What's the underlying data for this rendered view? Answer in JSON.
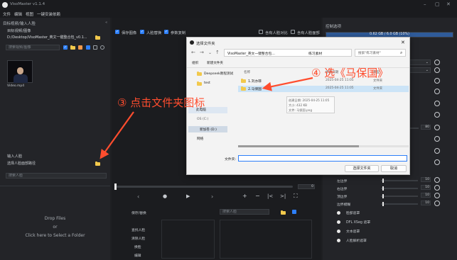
{
  "app": {
    "title": "VisoMaster v1.1.4"
  },
  "menu": [
    "文件",
    "编辑",
    "视图",
    "一键安装依赖"
  ],
  "left_panel": {
    "title": "目标视频/输入人脸",
    "target_label": "目标视频/图像",
    "target_path": "D:/Desktop/VisoMaster_英文一键整合包_v0.1...",
    "search_placeholder": "搜索视频/图像",
    "thumb_caption": "Video.mp4",
    "input_faces_label": "输入人脸",
    "input_faces_select": "选择人脸面部路径",
    "input_search_placeholder": "搜索人脸",
    "drop_files": "Drop Files",
    "or": "or",
    "click_select": "Click here to Select a Folder"
  },
  "center_top": {
    "checkbox1": "保存图像",
    "checkbox2": "人脸替换",
    "checkbox3": "参数复制",
    "right_cb1": "含有人脸对比",
    "right_cb2": "含有人脸面部"
  },
  "video_controls": {
    "frame_value": "0"
  },
  "bottom_center": {
    "save_label": "保存/替换",
    "search_face": "搜索人脸",
    "find_faces": "查找人脸",
    "clear_faces": "清除人脸",
    "swap": "换脸",
    "edit": "编辑"
  },
  "right_panel": {
    "title": "控制选项",
    "memory": "0.62 GB / 6.0 GB (10%)",
    "rows": [
      {
        "label": "左边界",
        "value": "10"
      },
      {
        "label": "右边界",
        "value": "10"
      },
      {
        "label": "顶边界",
        "value": "10"
      },
      {
        "label": "边界模糊",
        "value": "10"
      }
    ],
    "row_top_value": "80",
    "options": [
      "脸部遮罩",
      "DFL XSeg 遮罩",
      "文本遮罩",
      "人脸解析遮罩"
    ]
  },
  "dialog": {
    "title": "选择文件夹",
    "breadcrumb": [
      "VisoMaster_英文一键整合包...",
      "练习素材"
    ],
    "search_placeholder": "搜索\"练习素材\"",
    "toolbar_left": "新建文件夹",
    "toolbar_org": "组织",
    "tree": [
      "Deepseek教程测试",
      "test",
      "此电脑",
      "OS (C:)",
      "新加卷 (D:)",
      "网络"
    ],
    "columns": [
      "名称",
      "修改日期",
      "类型"
    ],
    "files": [
      {
        "name": "1.刘亦菲",
        "date": "2025-04-25 11:05",
        "type": "文件夹"
      },
      {
        "name": "2.马保国",
        "date": "2025-04-25 11:05",
        "type": "文件夹"
      }
    ],
    "tooltip": [
      "创建日期: 2025-04-25 11:05",
      "大小: 432 KB",
      "文件: 马保国.png"
    ],
    "folder_label": "文件夹:",
    "select_btn": "选择文件夹",
    "cancel_btn": "取消"
  },
  "annotations": {
    "step3": "③ 点击文件夹图标",
    "step4": "④ 选《马保国》"
  },
  "colors": {
    "accent": "#2d7ff9",
    "annotation": "#ff4d2e",
    "folder": "#f2c94c"
  }
}
